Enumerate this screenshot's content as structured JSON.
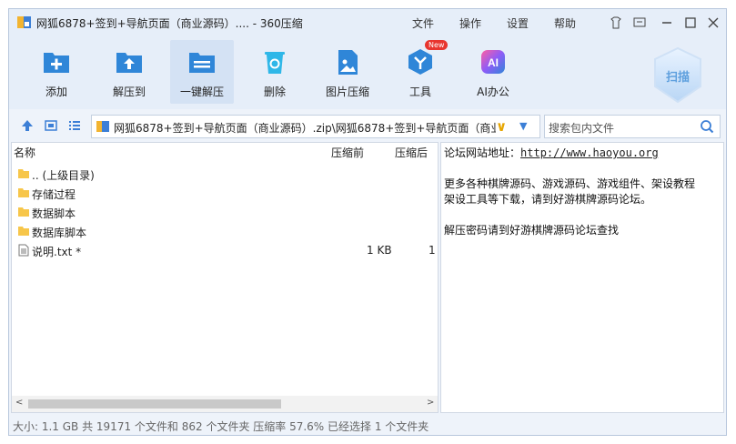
{
  "window": {
    "title": "网狐6878+签到+导航页面（商业源码）.... - 360压缩",
    "menu": [
      "文件",
      "操作",
      "设置",
      "帮助"
    ]
  },
  "toolbar": {
    "tools": [
      {
        "label": "添加",
        "icon": "add-icon"
      },
      {
        "label": "解压到",
        "icon": "extract-to-icon"
      },
      {
        "label": "一键解压",
        "icon": "one-click-extract-icon"
      },
      {
        "label": "删除",
        "icon": "delete-icon"
      },
      {
        "label": "图片压缩",
        "icon": "image-compress-icon"
      },
      {
        "label": "工具",
        "icon": "tools-icon",
        "badge": "New"
      },
      {
        "label": "AI办公",
        "icon": "ai-office-icon",
        "icon_text": "AI"
      }
    ],
    "scan_label": "扫描"
  },
  "address": {
    "path": "网狐6878+签到+导航页面（商业源码）.zip\\网狐6878+签到+导航页面（商业",
    "search_placeholder": "搜索包内文件"
  },
  "filelist": {
    "columns": {
      "name": "名称",
      "size": "压缩前",
      "csize": "压缩后"
    },
    "rows": [
      {
        "name": ".. (上级目录)",
        "type": "folder",
        "size": "",
        "csize": ""
      },
      {
        "name": "存储过程",
        "type": "folder",
        "size": "",
        "csize": ""
      },
      {
        "name": "数据脚本",
        "type": "folder",
        "size": "",
        "csize": ""
      },
      {
        "name": "数据库脚本",
        "type": "folder",
        "size": "",
        "csize": ""
      },
      {
        "name": "说明.txt *",
        "type": "file",
        "size": "1 KB",
        "csize": "1"
      }
    ]
  },
  "preview": {
    "label": "论坛网站地址：",
    "url": "http://www.haoyou.org",
    "line2": "更多各种棋牌源码、游戏源码、游戏组件、架设教程",
    "line3": "架设工具等下载，请到好游棋牌源码论坛。",
    "line4": "解压密码请到好游棋牌源码论坛查找"
  },
  "status": {
    "text": "大小: 1.1 GB 共 19171 个文件和 862 个文件夹 压缩率 57.6% 已经选择 1 个文件夹"
  },
  "colors": {
    "accent": "#2f86d8",
    "folder": "#f7c64a",
    "badge": "#e8352f"
  }
}
